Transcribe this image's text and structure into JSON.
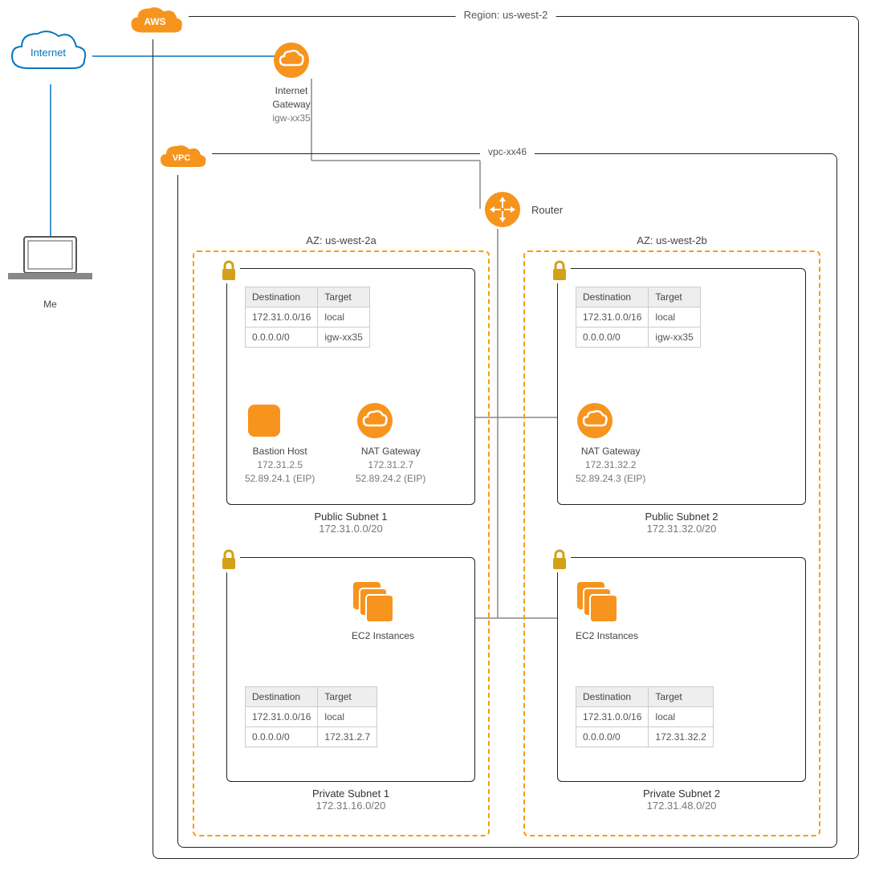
{
  "internet_label": "Internet",
  "me_label": "Me",
  "aws_badge": "AWS",
  "vpc_badge": "VPC",
  "region_label": "Region: us-west-2",
  "igw": {
    "title": "Internet\nGateway",
    "id": "igw-xx35"
  },
  "vpc": {
    "id": "vpc-xx46"
  },
  "router_label": "Router",
  "az1": {
    "label": "AZ: us-west-2a",
    "public": {
      "name": "Public Subnet 1",
      "cidr": "172.31.0.0/20",
      "rt": [
        {
          "dest": "172.31.0.0/16",
          "target": "local"
        },
        {
          "dest": "0.0.0.0/0",
          "target": "igw-xx35"
        }
      ],
      "bastion": {
        "title": "Bastion Host",
        "ip": "172.31.2.5",
        "eip": "52.89.24.1 (EIP)"
      },
      "nat": {
        "title": "NAT Gateway",
        "ip": "172.31.2.7",
        "eip": "52.89.24.2 (EIP)"
      }
    },
    "private": {
      "name": "Private Subnet 1",
      "cidr": "172.31.16.0/20",
      "ec2_label": "EC2 Instances",
      "rt": [
        {
          "dest": "172.31.0.0/16",
          "target": "local"
        },
        {
          "dest": "0.0.0.0/0",
          "target": "172.31.2.7"
        }
      ]
    }
  },
  "az2": {
    "label": "AZ: us-west-2b",
    "public": {
      "name": "Public Subnet 2",
      "cidr": "172.31.32.0/20",
      "rt": [
        {
          "dest": "172.31.0.0/16",
          "target": "local"
        },
        {
          "dest": "0.0.0.0/0",
          "target": "igw-xx35"
        }
      ],
      "nat": {
        "title": "NAT Gateway",
        "ip": "172.31.32.2",
        "eip": "52.89.24.3 (EIP)"
      }
    },
    "private": {
      "name": "Private Subnet 2",
      "cidr": "172.31.48.0/20",
      "ec2_label": "EC2 Instances",
      "rt": [
        {
          "dest": "172.31.0.0/16",
          "target": "local"
        },
        {
          "dest": "0.0.0.0/0",
          "target": "172.31.32.2"
        }
      ]
    }
  },
  "rt_headers": {
    "dest": "Destination",
    "target": "Target"
  }
}
